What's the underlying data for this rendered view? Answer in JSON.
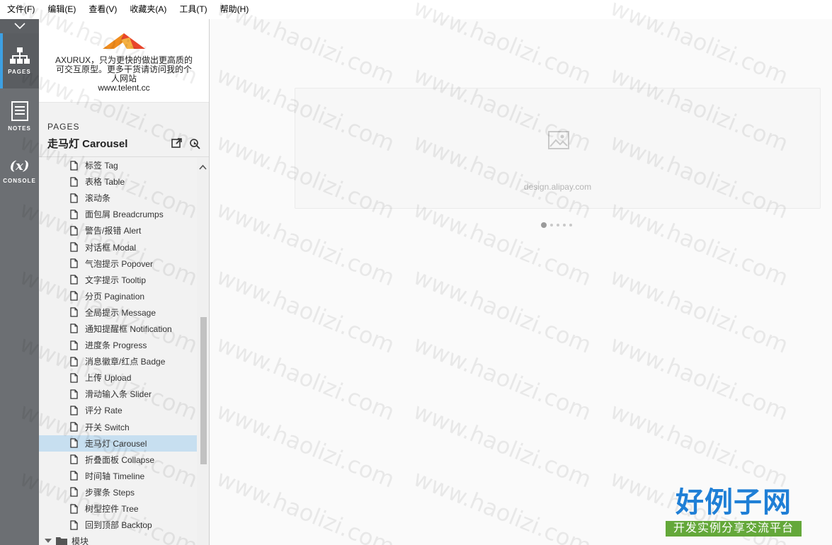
{
  "menubar": {
    "items": [
      "文件(F)",
      "编辑(E)",
      "查看(V)",
      "收藏夹(A)",
      "工具(T)",
      "帮助(H)"
    ]
  },
  "rail": {
    "pages_label": "PAGES",
    "notes_label": "NOTES",
    "console_label": "CONSOLE",
    "console_glyph": "(x)"
  },
  "brand": {
    "text_line1": "AXURUX，只为更快的做出更高质的",
    "text_line2": "可交互原型。更多干货请访问我的个",
    "text_line3": "人网站",
    "text_line4": "www.telent.cc",
    "colors": {
      "logo_orange": "#f08c1e",
      "logo_red": "#e8452c"
    }
  },
  "pages_panel": {
    "label": "PAGES",
    "current_title": "走马灯 Carousel",
    "items": [
      "标签 Tag",
      "表格 Table",
      "滚动条",
      "面包屑 Breadcrumps",
      "警告/报错 Alert",
      "对话框 Modal",
      "气泡提示 Popover",
      "文字提示 Tooltip",
      "分页 Pagination",
      "全局提示 Message",
      "通知提醒框 Notification",
      "进度条 Progress",
      "消息徽章/红点 Badge",
      "上传 Upload",
      "滑动输入条 Slider",
      "评分 Rate",
      "开关 Switch",
      "走马灯 Carousel",
      "折叠面板 Collapse",
      "时间轴 Timeline",
      "步骤条 Steps",
      "树型控件 Tree",
      "回到顶部 Backtop"
    ],
    "selected_index": 17,
    "folder_label": "模块",
    "colors": {
      "selected_bg": "#c7dff0",
      "active_accent": "#3da0e3"
    }
  },
  "canvas": {
    "carousel_caption": "design.alipay.com",
    "dot_count": 5,
    "active_dot": 0
  },
  "watermark": {
    "text": "www.haolizi.com"
  },
  "corner_badge": {
    "title": "好例子网",
    "subtitle": "开发实例分享交流平台",
    "colors": {
      "title": "#1f7fd6",
      "subtitle_bg": "#64a83a"
    }
  }
}
